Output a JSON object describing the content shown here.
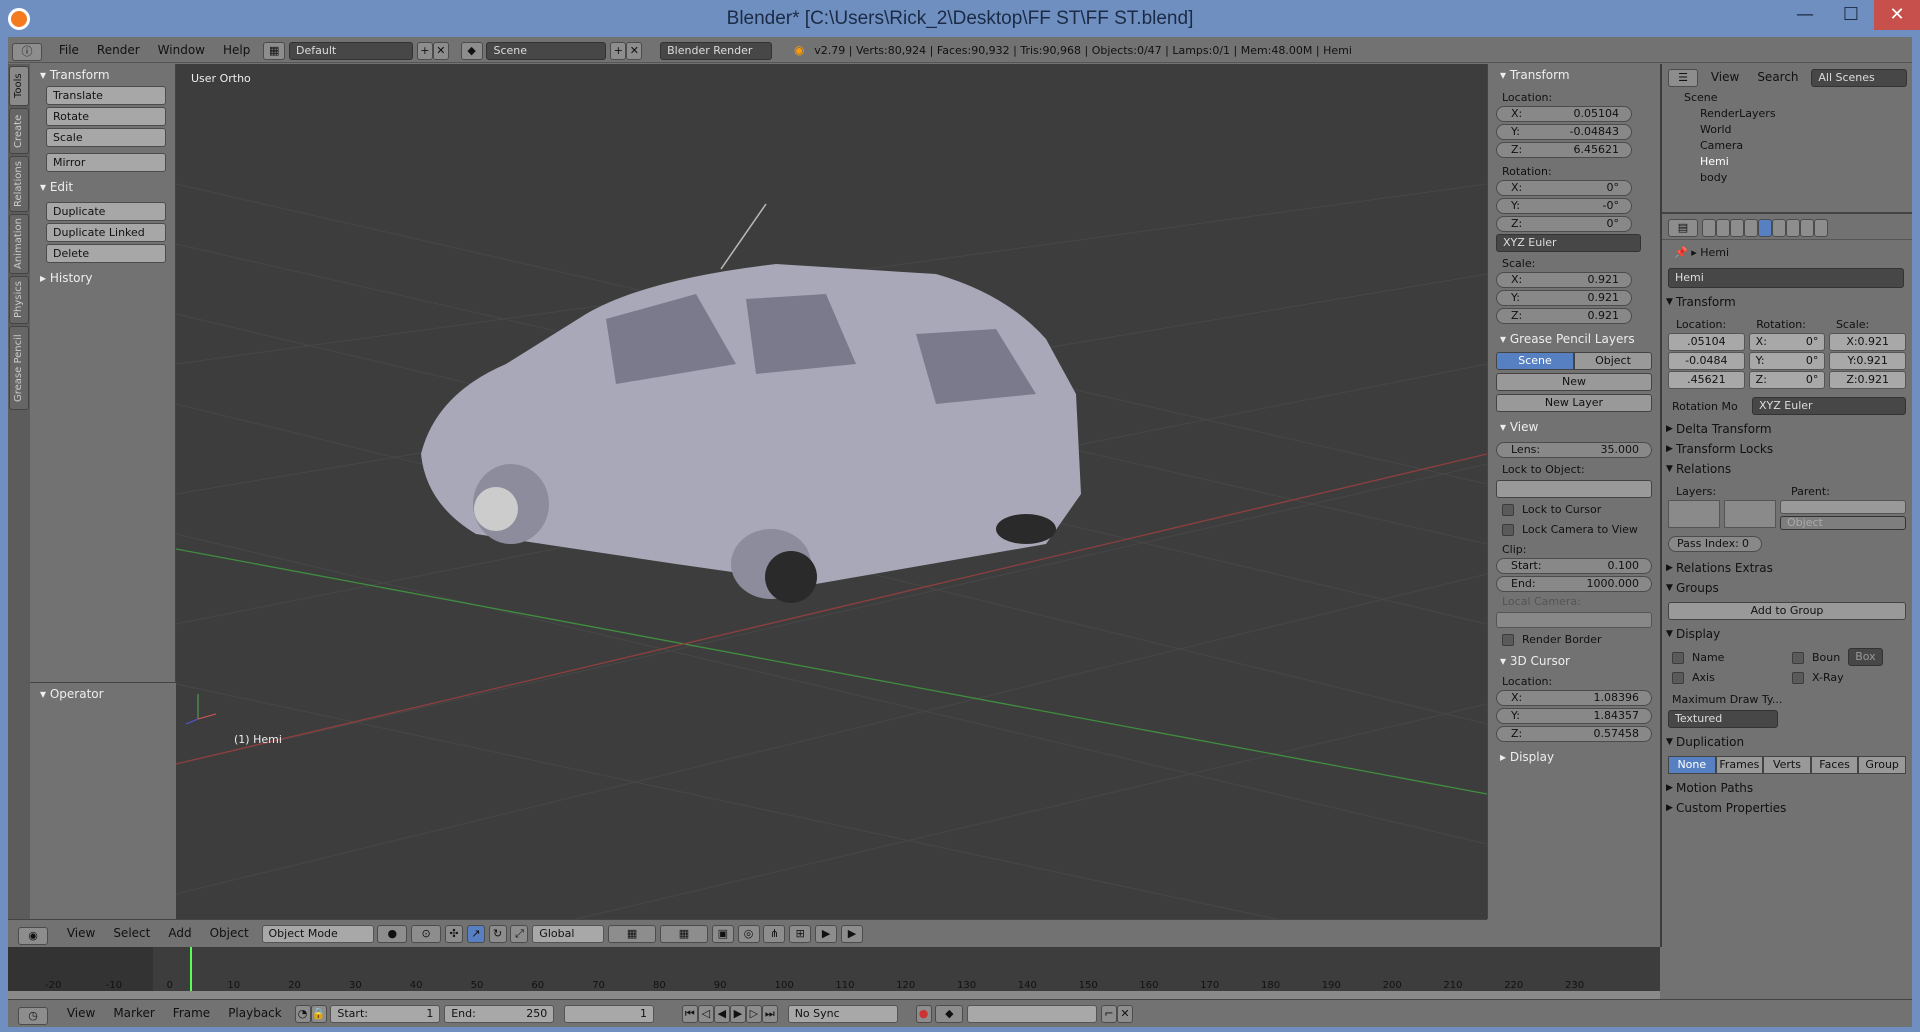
{
  "window": {
    "title": "Blender* [C:\\Users\\Rick_2\\Desktop\\FF ST\\FF ST.blend]"
  },
  "menubar": {
    "items": [
      "File",
      "Render",
      "Window",
      "Help"
    ],
    "layout": "Default",
    "scene": "Scene",
    "engine": "Blender Render",
    "stats": "v2.79 | Verts:80,924 | Faces:90,932 | Tris:90,968 | Objects:0/47 | Lamps:0/1 | Mem:48.00M | Hemi"
  },
  "tabs": [
    "Tools",
    "Create",
    "Relations",
    "Animation",
    "Physics",
    "Grease Pencil"
  ],
  "tools": {
    "transform_header": "Transform",
    "transform": [
      "Translate",
      "Rotate",
      "Scale"
    ],
    "mirror": "Mirror",
    "edit_header": "Edit",
    "edit": [
      "Duplicate",
      "Duplicate Linked",
      "Delete"
    ],
    "history": "History",
    "operator": "Operator"
  },
  "viewport": {
    "view_label": "User Ortho",
    "object_label": "(1) Hemi"
  },
  "vpmenu": {
    "items": [
      "View",
      "Select",
      "Add",
      "Object"
    ],
    "mode": "Object Mode",
    "orientation": "Global"
  },
  "npanel": {
    "transform": "Transform",
    "location": "Location:",
    "loc": [
      [
        "X:",
        "0.05104"
      ],
      [
        "Y:",
        "-0.04843"
      ],
      [
        "Z:",
        "6.45621"
      ]
    ],
    "rotation": "Rotation:",
    "rot": [
      [
        "X:",
        "0°"
      ],
      [
        "Y:",
        "-0°"
      ],
      [
        "Z:",
        "0°"
      ]
    ],
    "rotmode": "XYZ Euler",
    "scale": "Scale:",
    "scl": [
      [
        "X:",
        "0.921"
      ],
      [
        "Y:",
        "0.921"
      ],
      [
        "Z:",
        "0.921"
      ]
    ],
    "gp": "Grease Pencil Layers",
    "gp_scene": "Scene",
    "gp_object": "Object",
    "gp_new": "New",
    "gp_newlayer": "New Layer",
    "view": "View",
    "lens": [
      "Lens:",
      "35.000"
    ],
    "lock_obj": "Lock to Object:",
    "lock_cursor": "Lock to Cursor",
    "lock_cam": "Lock Camera to View",
    "clip": "Clip:",
    "clip_start": [
      "Start:",
      "0.100"
    ],
    "clip_end": [
      "End:",
      "1000.000"
    ],
    "local_cam": "Local Camera:",
    "render_border": "Render Border",
    "cursor": "3D Cursor",
    "cursor_loc": "Location:",
    "cur": [
      [
        "X:",
        "1.08396"
      ],
      [
        "Y:",
        "1.84357"
      ],
      [
        "Z:",
        "0.57458"
      ]
    ],
    "display": "Display"
  },
  "outliner": {
    "menus": [
      "View",
      "Search"
    ],
    "scenes": "All Scenes",
    "rows": [
      "Scene",
      "RenderLayers",
      "World",
      "Camera",
      "Hemi",
      "body"
    ]
  },
  "props": {
    "object": "Hemi",
    "name": "Hemi",
    "transform": "Transform",
    "loc_l": "Location:",
    "rot_l": "Rotation:",
    "scl_l": "Scale:",
    "loc": [
      ".05104",
      "-0.0484",
      ".45621"
    ],
    "rot": [
      [
        "X:",
        "0°"
      ],
      [
        "Y:",
        "0°"
      ],
      [
        "Z:",
        "0°"
      ]
    ],
    "scl": [
      "X:0.921",
      "Y:0.921",
      "Z:0.921"
    ],
    "rotmode_l": "Rotation Mo",
    "rotmode": "XYZ Euler",
    "delta": "Delta Transform",
    "locks": "Transform Locks",
    "relations": "Relations",
    "layers": "Layers:",
    "parent": "Parent:",
    "parent_type": "Object",
    "pass": "Pass Index:",
    "pass_v": "0",
    "rel_extras": "Relations Extras",
    "groups": "Groups",
    "add_group": "Add to Group",
    "display": "Display",
    "d_name": "Name",
    "d_bound": "Boun",
    "d_box": "Box",
    "d_axis": "Axis",
    "d_xray": "X-Ray",
    "maxdraw": "Maximum Draw Ty...",
    "textured": "Textured",
    "dup": "Duplication",
    "dup_opts": [
      "None",
      "Frames",
      "Verts",
      "Faces",
      "Group"
    ],
    "motion": "Motion Paths",
    "custom": "Custom Properties"
  },
  "timeline": {
    "ticks": [
      "-20",
      "-10",
      "0",
      "10",
      "20",
      "30",
      "40",
      "50",
      "60",
      "70",
      "80",
      "90",
      "100",
      "110",
      "120",
      "130",
      "140",
      "150",
      "160",
      "170",
      "180",
      "190",
      "200",
      "210",
      "220",
      "230"
    ],
    "menus": [
      "View",
      "Marker",
      "Frame",
      "Playback"
    ],
    "start": "Start:",
    "start_v": "1",
    "end": "End:",
    "end_v": "250",
    "current": "1",
    "sync": "No Sync"
  }
}
